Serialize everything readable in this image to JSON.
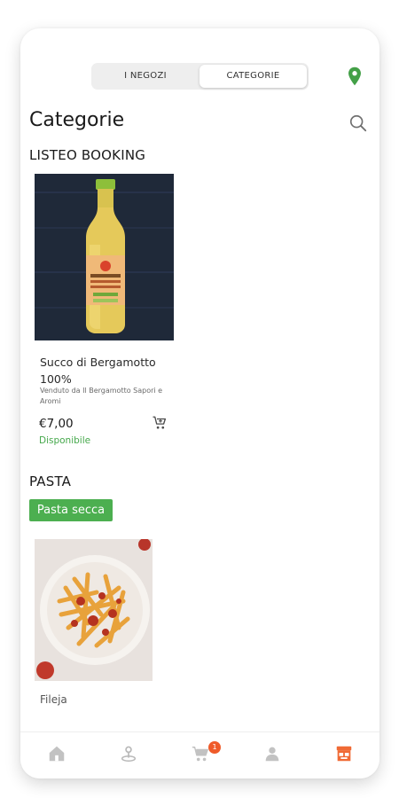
{
  "header": {
    "tabs": [
      {
        "label": "I NEGOZI",
        "selected": false
      },
      {
        "label": "CATEGORIE",
        "selected": true
      }
    ],
    "location_icon": "map-pin-icon",
    "accent_color": "#43a047"
  },
  "page_title": "Categorie",
  "search_icon": "search-icon",
  "sections": [
    {
      "title": "LISTEO BOOKING",
      "products": [
        {
          "name": "Succo di Bergamotto 100%",
          "seller": "Venduto da Il Bergamotto Sapori e Aromi",
          "price": "€7,00",
          "availability": "Disponibile",
          "add_to_cart_icon": "add-to-cart-icon"
        }
      ]
    },
    {
      "title": "PASTA",
      "subcategory_chip": "Pasta secca",
      "products": [
        {
          "name": "Fileja"
        }
      ]
    }
  ],
  "bottom_nav": {
    "items": [
      {
        "icon": "home-icon"
      },
      {
        "icon": "explore-icon"
      },
      {
        "icon": "cart-icon",
        "badge": "1"
      },
      {
        "icon": "profile-icon"
      },
      {
        "icon": "store-icon",
        "active": true
      }
    ],
    "active_color": "#f06a35",
    "badge_color": "#ef5b2a"
  }
}
